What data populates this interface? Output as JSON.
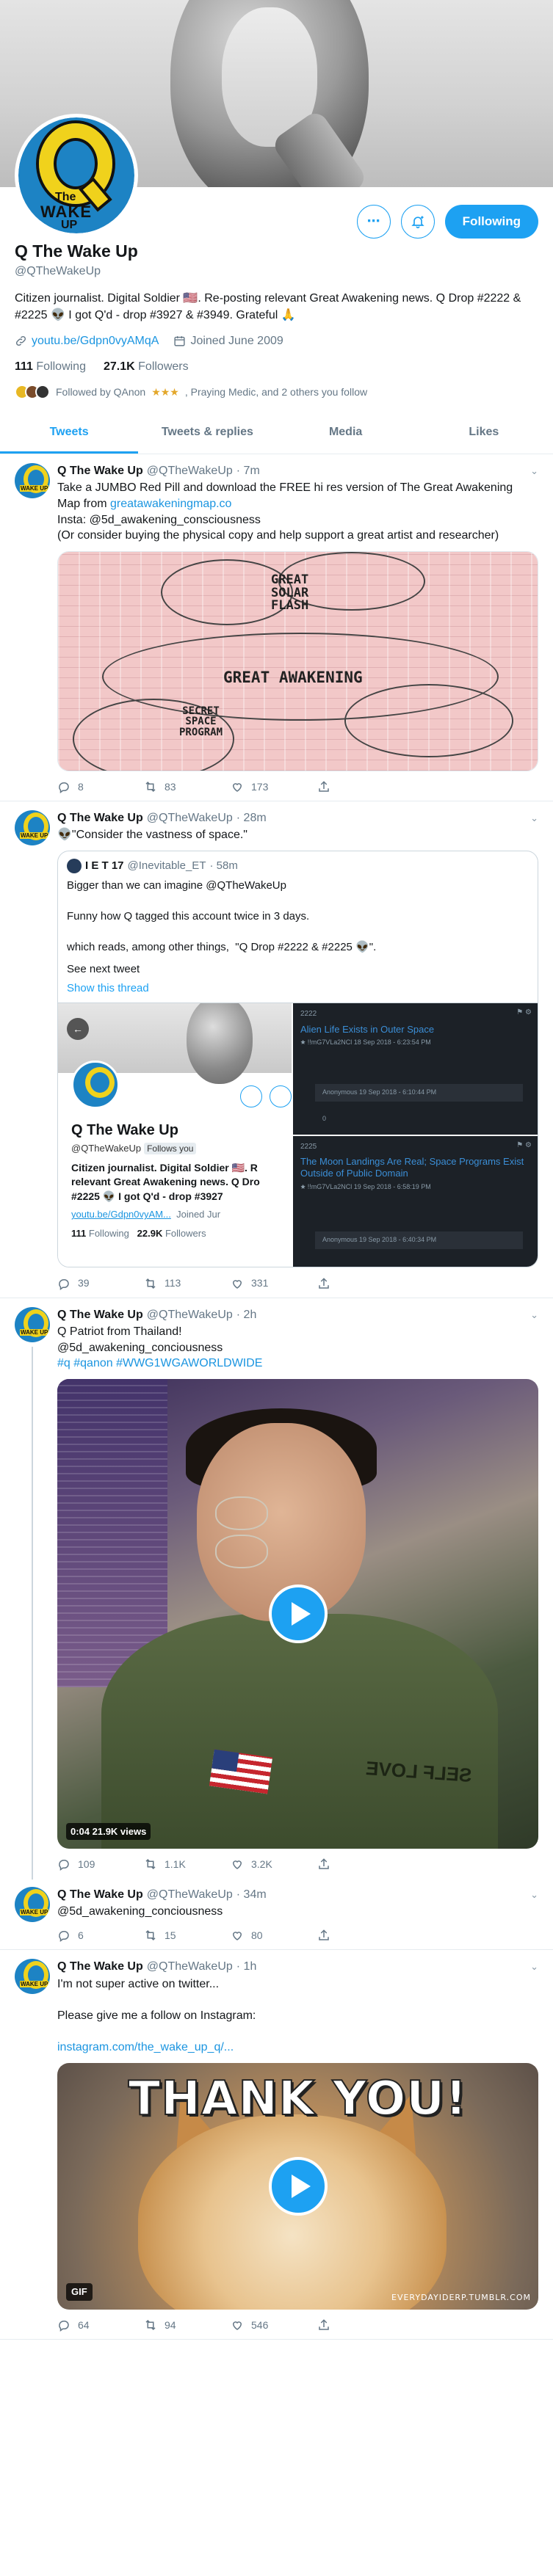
{
  "profile": {
    "name": "Q The Wake Up",
    "handle": "@QTheWakeUp",
    "avatar_text": {
      "the": "The",
      "wake": "WAKE",
      "up": "UP"
    },
    "bio": "Citizen journalist. Digital Soldier 🇺🇸. Re-posting relevant Great Awakening news. Q Drop #2222 & #2225 👽 I got Q'd - drop #3927 & #3949. Grateful 🙏",
    "link": "youtu.be/Gdpn0vyAMqA",
    "joined": "Joined June 2009",
    "following_count": "111",
    "following_label": "Following",
    "followers_count": "27.1K",
    "followers_label": "Followers",
    "followed_by": "Followed by QAnon",
    "followed_by_rest": ", Praying Medic, and 2 others you follow",
    "stars": "★★★",
    "follow_button": "Following",
    "more_icon": "⋯",
    "notify_icon": "🔔"
  },
  "tabs": [
    {
      "label": "Tweets"
    },
    {
      "label": "Tweets & replies"
    },
    {
      "label": "Media"
    },
    {
      "label": "Likes"
    }
  ],
  "tweets": [
    {
      "name": "Q The Wake Up",
      "handle": "@QTheWakeUp",
      "time": "· 7m",
      "text_before": "Take a JUMBO Red Pill and download the FREE hi res version of The Great Awakening Map from ",
      "link": "greatawakeningmap.co",
      "text_after": "\nInsta: @5d_awakening_consciousness\n(Or consider buying the physical copy and help support a great artist and researcher)",
      "map_labels": {
        "great_solar_flash": "GREAT\nSOLAR\nFLASH",
        "great_awakening": "GREAT AWAKENING",
        "secret_space": "SECRET\nSPACE\nPROGRAM"
      },
      "replies": "8",
      "retweets": "83",
      "likes": "173"
    },
    {
      "name": "Q The Wake Up",
      "handle": "@QTheWakeUp",
      "time": "· 28m",
      "text": "👽\"Consider the vastness of space.\"",
      "quote": {
        "name": "I E T 17",
        "handle": "@Inevitable_ET",
        "time": "· 58m",
        "text": "Bigger than we can imagine @QTheWakeUp\n\nFunny how Q tagged this account twice in 3 days.\n\nwhich reads, among other things,  \"Q Drop #2222 & #2225 👽\".",
        "see_next": "See next tweet",
        "show_thread": "Show this thread",
        "inner_profile": {
          "name": "Q The Wake Up",
          "handle": "@QTheWakeUp",
          "follows_you": "Follows you",
          "bio": "Citizen journalist. Digital Soldier 🇺🇸. R\nrelevant Great Awakening news. Q Dro\n#2225 👽 I got Q'd - drop #3927",
          "link": "youtu.be/Gdpn0vyAM...",
          "joined": "Joined Jur",
          "following": "111",
          "following_label": "Following",
          "followers": "22.9K",
          "followers_label": "Followers"
        },
        "drop1": {
          "num": "2222",
          "title": "Alien Life Exists in Outer Space",
          "meta": "🟊 !!mG7VLa2NCl  18 Sep 2018 - 6:23:54 PM",
          "anon": "Anonymous   19 Sep 2018 - 6:10:44 PM",
          "zero": "0"
        },
        "drop2": {
          "num": "2225",
          "title": "The Moon Landings Are Real; Space Programs Exist Outside of Public Domain",
          "meta": "🟊 !!mG7VLa2NCl  19 Sep 2018 - 6:58:19 PM",
          "anon": "Anonymous   19 Sep 2018 - 6:40:34 PM"
        }
      },
      "replies": "39",
      "retweets": "113",
      "likes": "331"
    },
    {
      "name": "Q The Wake Up",
      "handle": "@QTheWakeUp",
      "time": "· 2h",
      "text_line1": "Q Patriot from Thailand!",
      "text_line2": "@5d_awakening_conciousness",
      "hashtags": "#q #qanon #WWG1WGAWORLDWIDE",
      "video_badge": "0:04  21.9K views",
      "shirt_text": "SELF LOVE",
      "replies": "109",
      "retweets": "1.1K",
      "likes": "3.2K"
    },
    {
      "name": "Q The Wake Up",
      "handle": "@QTheWakeUp",
      "time": "· 34m",
      "text": "@5d_awakening_conciousness",
      "replies": "6",
      "retweets": "15",
      "likes": "80"
    },
    {
      "name": "Q The Wake Up",
      "handle": "@QTheWakeUp",
      "time": "· 1h",
      "text_line1": "I'm not super active on twitter...",
      "text_line2": "Please give me a follow on Instagram:",
      "link": "instagram.com/the_wake_up_q/...",
      "gif_text": "THANK YOU!",
      "gif_caption": "EVERYDAYIDERP.TUMBLR.COM",
      "gif_badge": "GIF",
      "replies": "64",
      "retweets": "94",
      "likes": "546"
    }
  ],
  "colors": {
    "accent": "#1da1f2",
    "link": "#1b95e0",
    "muted": "#657786"
  }
}
